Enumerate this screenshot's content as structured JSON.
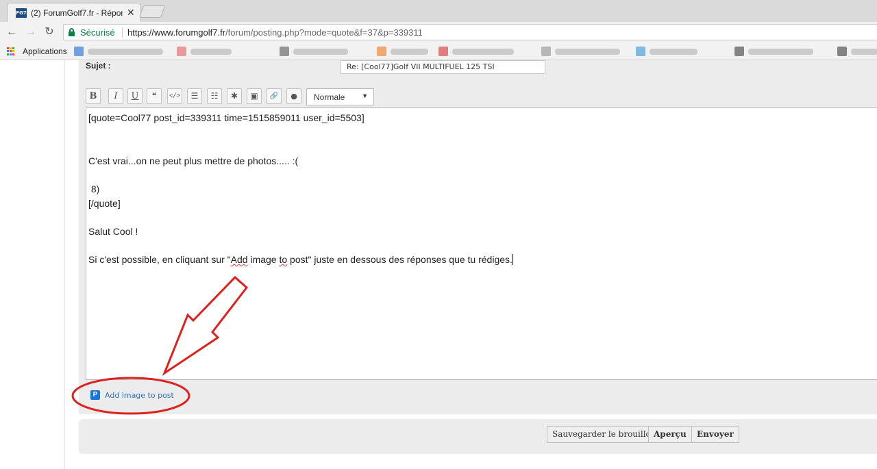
{
  "browser": {
    "tab_title": "(2) ForumGolf7.fr - Répon",
    "favicon_text": "FG7",
    "tab_close": "✕",
    "secure_label": "Sécurisé",
    "url_host": "https://www.forumgolf7.fr",
    "url_path": "/forum/posting.php?mode=quote&f=37&p=339311",
    "back_glyph": "←",
    "forward_glyph": "→",
    "reload_glyph": "↻"
  },
  "bookmarks": {
    "apps_label": "Applications",
    "apps_colors": [
      "#ea4335",
      "#fbbc05",
      "#34a853",
      "#4285f4",
      "#ea4335",
      "#fbbc05",
      "#34a853",
      "#4285f4",
      "#ea4335"
    ],
    "items": [
      {
        "icon_color": "#3b7dd8"
      },
      {
        "icon_color": "#e57373"
      },
      {
        "icon_color": "#6d6d6d"
      },
      {
        "icon_color": "#ef8a3a"
      },
      {
        "icon_color": "#d84b4b"
      },
      {
        "icon_color": "#9e9e9e"
      },
      {
        "icon_color": "#4fa3e0"
      },
      {
        "icon_color": "#555555"
      },
      {
        "icon_color": "#555555"
      }
    ]
  },
  "form": {
    "subject_label": "Sujet :",
    "subject_value": "Re: [Cool77]Golf VII MULTIFUEL 125 TSI",
    "toolbar": {
      "bold": "B",
      "italic": "I",
      "underline": "U",
      "quote": "❝",
      "code": "</>",
      "list": "☰",
      "list_numbered": "☷",
      "special": "✱",
      "image": "▣",
      "link": "🔗",
      "color": "●",
      "size_select": "Normale",
      "size_arrow": "▼"
    },
    "editor_lines": {
      "l1": "[quote=Cool77 post_id=339311 time=1515859011 user_id=5503]",
      "l2": "C'est vrai...on ne peut plus mettre de photos..... :(",
      "l3": " 8)",
      "l4": "[/quote]",
      "l5": "Salut Cool !",
      "l6a": "Si c'est possible, en cliquant sur \"",
      "l6b": "Add",
      "l6c": " image ",
      "l6d": "to",
      "l6e": " post\" juste en dessous des réponses que tu rédiges."
    },
    "add_image": {
      "icon": "P",
      "label": "Add image to post"
    },
    "buttons": {
      "save_draft": "Sauvegarder le brouillon",
      "preview": "Aperçu",
      "submit": "Envoyer"
    }
  },
  "annotation": {
    "color": "#e0201c"
  }
}
